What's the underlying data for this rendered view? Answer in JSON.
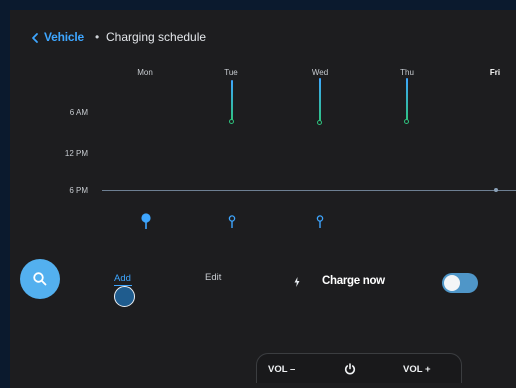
{
  "header": {
    "parent": "Vehicle",
    "separator": "•",
    "current": "Charging schedule"
  },
  "days": [
    "Mon",
    "Tue",
    "Wed",
    "Thu",
    "Fri"
  ],
  "time_labels": [
    "6 AM",
    "12 PM",
    "6 PM"
  ],
  "actions": {
    "add_label": "Add",
    "edit_label": "Edit",
    "charge_now_label": "Charge now",
    "charge_now_on": false
  },
  "softkeys": {
    "vol_down": "VOL –",
    "vol_up": "VOL +"
  },
  "icons": {
    "back": "chevron-left-icon",
    "search": "search-icon",
    "bolt": "bolt-icon",
    "power": "power-icon"
  },
  "colors": {
    "accent": "#3ea6ff",
    "bar_gradient_top": "#3ea6ff",
    "bar_gradient_bottom": "#2ec27e",
    "background": "#1d1d1f",
    "toggle": "#4f96c8"
  }
}
